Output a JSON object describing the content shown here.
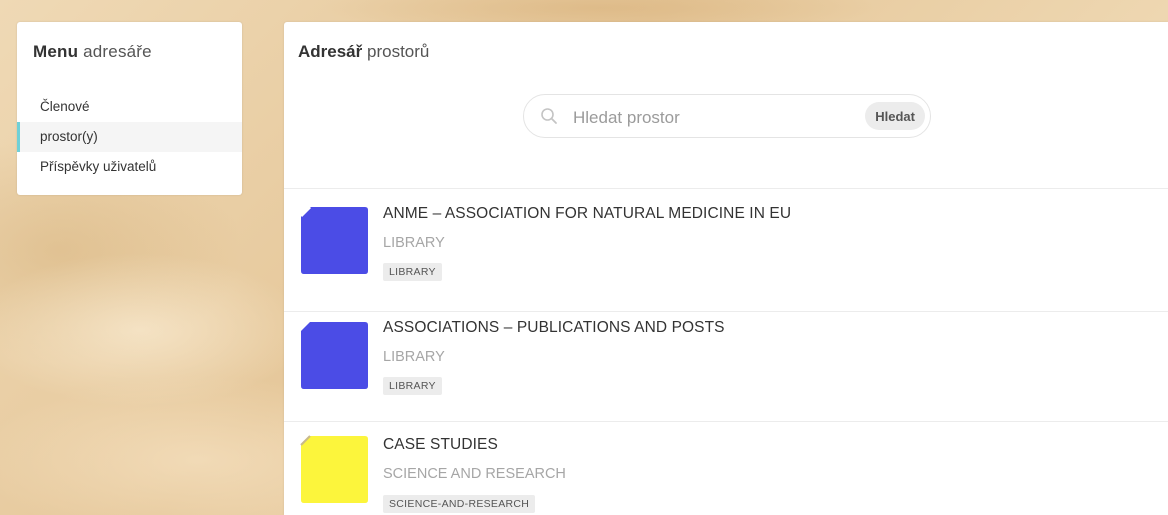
{
  "sidebar": {
    "title_bold": "Menu",
    "title_rest": "adresáře",
    "items": [
      {
        "label": "Členové",
        "active": false
      },
      {
        "label": "prostor(y)",
        "active": true
      },
      {
        "label": "Příspěvky uživatelů",
        "active": false
      }
    ]
  },
  "main": {
    "title_bold": "Adresář",
    "title_rest": "prostorů",
    "search": {
      "placeholder": "Hledat prostor",
      "value": "",
      "button_label": "Hledat",
      "icon": "search-icon"
    },
    "entries": [
      {
        "title": "ANME – ASSOCIATION FOR NATURAL MEDICINE IN EU",
        "category": "LIBRARY",
        "tag": "LIBRARY",
        "icon_color": "#4b4ce6"
      },
      {
        "title": "ASSOCIATIONS – PUBLICATIONS AND POSTS",
        "category": "LIBRARY",
        "tag": "LIBRARY",
        "icon_color": "#4b4ce6"
      },
      {
        "title": "CASE STUDIES",
        "category": "SCIENCE AND RESEARCH",
        "tag": "SCIENCE-AND-RESEARCH",
        "icon_color": "#fcf53c"
      }
    ]
  },
  "colors": {
    "active_indicator": "#6fd0d7",
    "tag_background": "#ececec"
  }
}
